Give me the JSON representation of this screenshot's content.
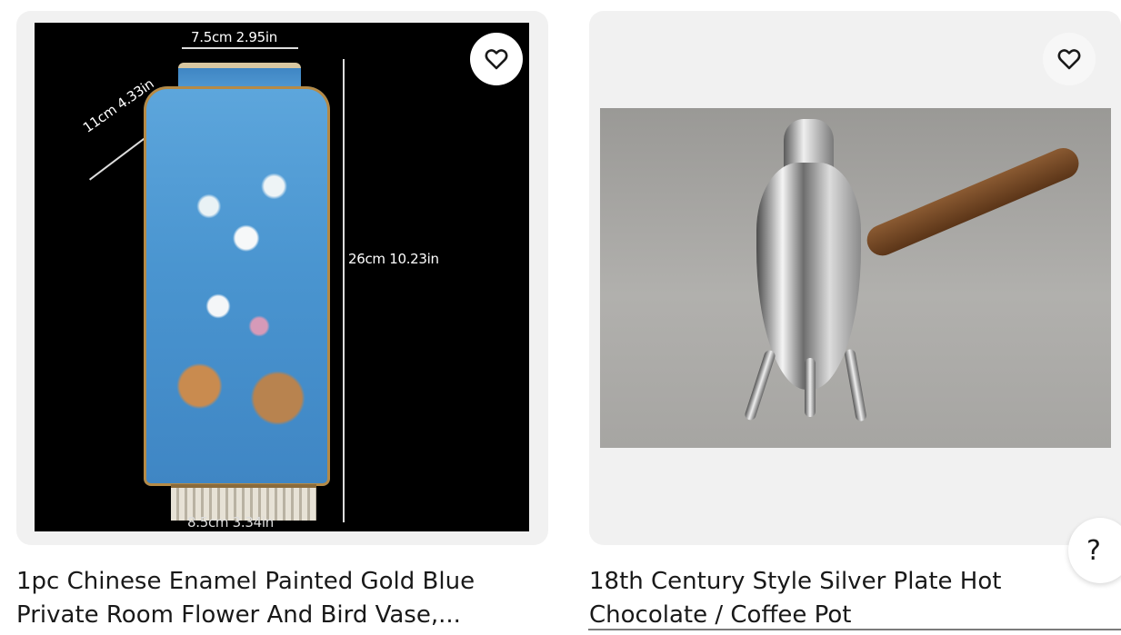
{
  "listings": [
    {
      "title_line_1": "1pc Chinese Enamel Painted Gold Blue",
      "title_line_2": "Private Room Flower And Bird Vase,...",
      "image_labels": {
        "top_width": "7.5cm 2.95in",
        "depth": "11cm 4.33in",
        "height": "26cm 10.23in",
        "base_width": "8.5cm 3.34in"
      },
      "favorite_icon": "heart-outline-icon"
    },
    {
      "title_line_1": "18th Century Style Silver Plate Hot",
      "title_line_2": "Chocolate / Coffee Pot",
      "favorite_icon": "heart-outline-icon"
    }
  ],
  "help_button": {
    "label": "?"
  },
  "colors": {
    "text": "#191919",
    "image_background": "#f1f1f1",
    "favorite_background": "#ffffff"
  }
}
